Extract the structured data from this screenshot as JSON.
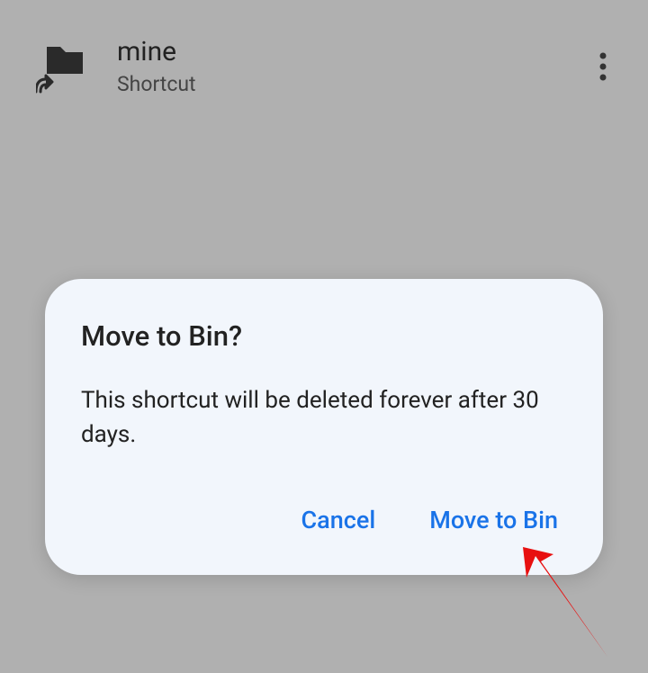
{
  "item": {
    "title": "mine",
    "subtitle": "Shortcut"
  },
  "dialog": {
    "title": "Move to Bin?",
    "body": "This shortcut will be deleted forever after 30 days.",
    "cancel_label": "Cancel",
    "confirm_label": "Move to Bin"
  }
}
